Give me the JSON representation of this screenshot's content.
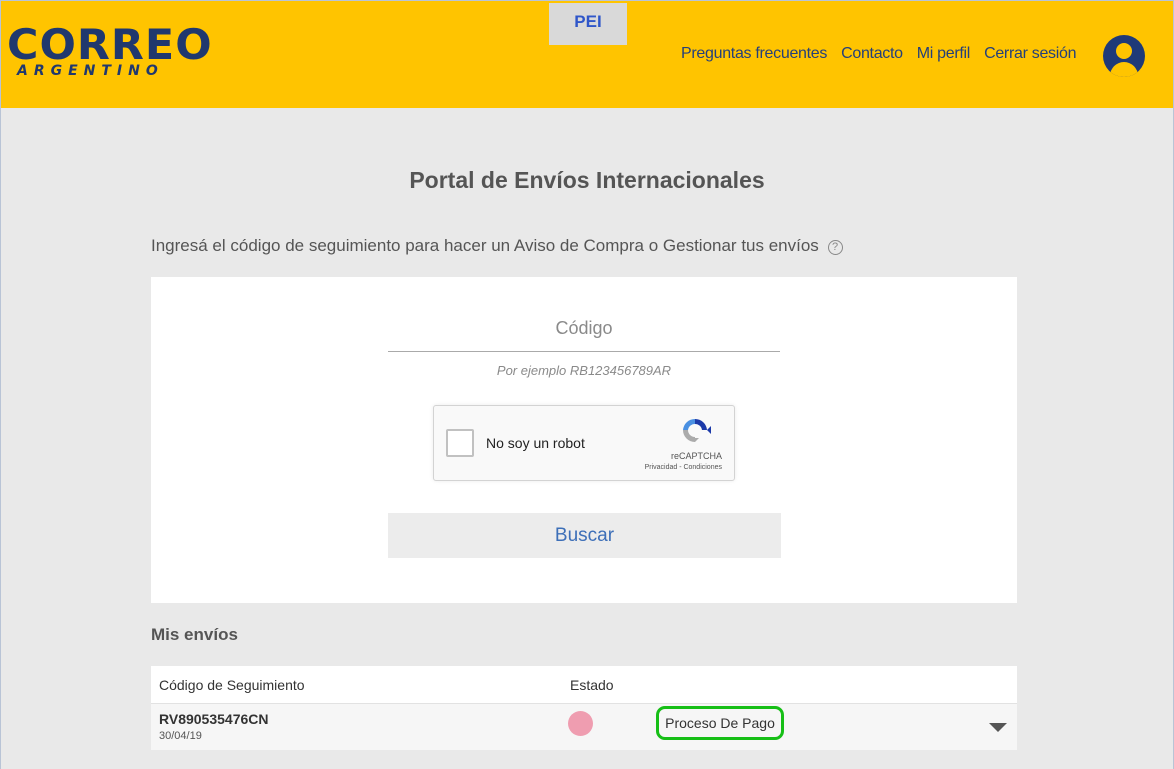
{
  "header": {
    "logo_main": "CORREO",
    "logo_sub": "ARGENTINO",
    "tab_label": "PEI",
    "nav": [
      "Preguntas frecuentes",
      "Contacto",
      "Mi perfil",
      "Cerrar sesión"
    ]
  },
  "main": {
    "title": "Portal de Envíos Internacionales",
    "instruction": "Ingresá el código de seguimiento para hacer un Aviso de Compra o Gestionar tus envíos",
    "help_icon": "?",
    "code_placeholder": "Código",
    "hint": "Por ejemplo RB123456789AR",
    "captcha": {
      "label": "No soy un robot",
      "brand": "reCAPTCHA",
      "links": "Privacidad - Condiciones"
    },
    "search_label": "Buscar"
  },
  "shipments": {
    "title": "Mis envíos",
    "columns": [
      "Código de Seguimiento",
      "Estado"
    ],
    "rows": [
      {
        "tracking": "RV890535476CN",
        "date": "30/04/19",
        "status": "Proceso De Pago",
        "status_color": "#ef9db0"
      }
    ]
  },
  "colors": {
    "header_bg": "#ffc400",
    "brand_blue": "#20386e",
    "highlight": "#16bf16"
  }
}
